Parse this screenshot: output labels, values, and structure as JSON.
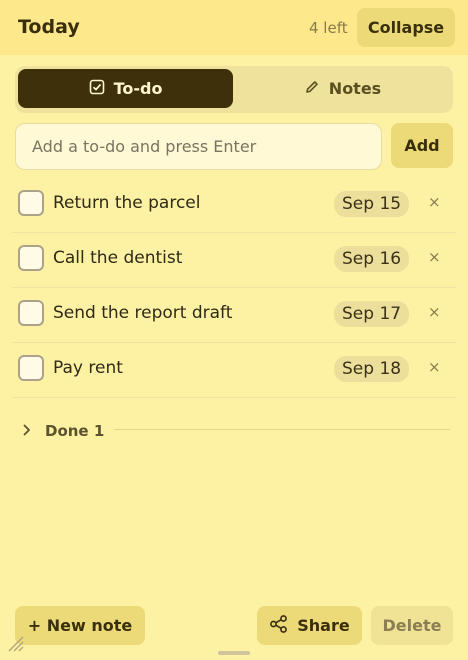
{
  "header": {
    "title": "Today",
    "count": "4 left",
    "collapse_label": "Collapse"
  },
  "tabs": [
    {
      "label": "To-do",
      "icon": "checkbox-icon",
      "active": true
    },
    {
      "label": "Notes",
      "icon": "pencil-icon",
      "active": false
    }
  ],
  "composer": {
    "placeholder": "Add a to-do and press Enter",
    "value": "",
    "add_label": "Add"
  },
  "todos": [
    {
      "text": "Return the parcel",
      "date": "Sep 15",
      "remove": "×"
    },
    {
      "text": "Call the dentist",
      "date": "Sep 16",
      "remove": "×"
    },
    {
      "text": "Send the report draft",
      "date": "Sep 17",
      "remove": "×"
    },
    {
      "text": "Pay rent",
      "date": "Sep 18",
      "remove": "×"
    }
  ],
  "done_section": {
    "label": "Done 1"
  },
  "footer": {
    "new_note_label": "+ New note",
    "share_label": "Share",
    "delete_label": "Delete"
  },
  "colors": {
    "background": "#fdf1a4",
    "header": "#fde98b",
    "active_tab": "#3e300a",
    "button": "#ecd978"
  }
}
